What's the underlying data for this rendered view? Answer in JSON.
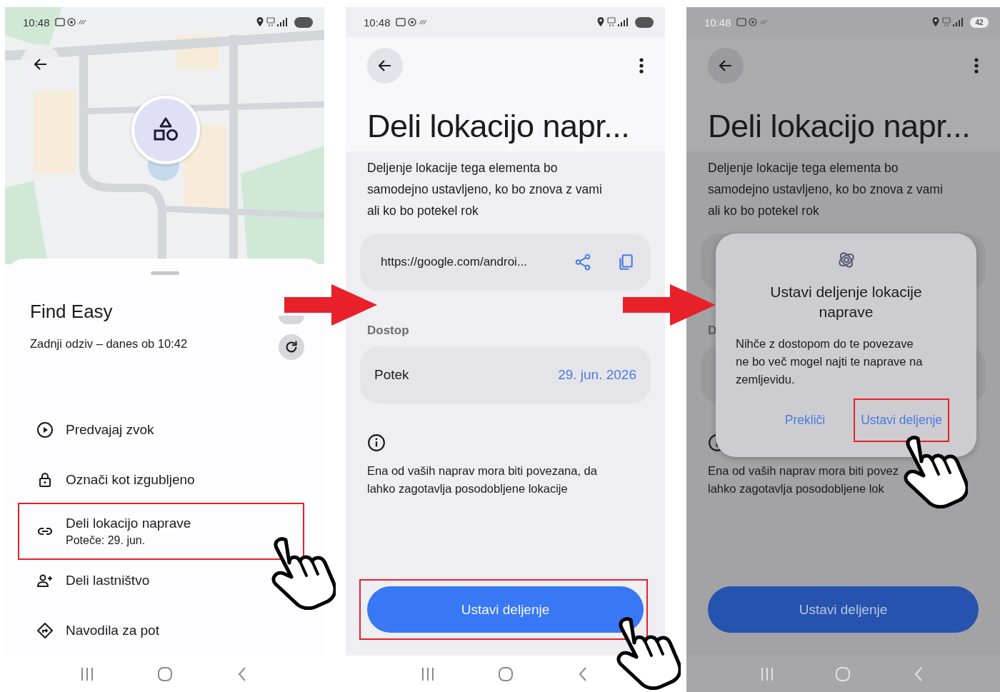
{
  "panels": [
    {
      "kind": "map_sheet",
      "status_bar": {
        "time": "10:48"
      },
      "sheet": {
        "title": "Find Easy",
        "subtitle": "Zadnji odziv – danes ob 10:42",
        "menu": [
          {
            "label": "Predvajaj zvok",
            "highlighted": false
          },
          {
            "label": "Označi kot izgubljeno",
            "highlighted": false
          },
          {
            "label": "Deli lokacijo naprave",
            "detail": "Poteče: 29. jun.",
            "highlighted": true
          },
          {
            "label": "Deli lastništvo",
            "highlighted": false
          },
          {
            "label": "Navodila za pot",
            "highlighted": false
          }
        ]
      }
    },
    {
      "kind": "share_detail",
      "dimmed": false,
      "status_bar": {
        "time": "10:48"
      },
      "title": "Deli lokacijo napr...",
      "description": "Deljenje lokacije tega elementa bo\nsamodejno ustavljeno, ko bo znova z vami\nali ko bo potekel rok",
      "link": {
        "url": "https://google.com/androi..."
      },
      "section_label": "Dostop",
      "expiry": {
        "label": "Potek",
        "value": "29. jun. 2026"
      },
      "info": "Ena od vaših naprav mora biti povezana, da\nlahko zagotavlja posodobljene lokacije",
      "button": {
        "label": "Ustavi deljenje",
        "highlighted": true
      }
    },
    {
      "kind": "share_detail",
      "dimmed": true,
      "status_bar": {
        "time": "10:48",
        "battery": "42"
      },
      "title": "Deli lokacijo napr...",
      "description": "Deljenje lokacije tega elementa bo\nsamodejno ustavljeno, ko bo znova z vami\nali ko bo potekel rok",
      "section_label": "D",
      "info": "Ena od vaših naprav mora biti povez\nlahko zagotavlja posodobljene lok",
      "button": {
        "label": "Ustavi deljenje",
        "highlighted": false
      },
      "dialog": {
        "title": "Ustavi deljenje lokacije naprave",
        "body": "Nihče z dostopom do te povezave\nne bo več mogel najti te naprave na\nzemljevidu.",
        "buttons": [
          {
            "label": "Prekliči",
            "highlighted": false
          },
          {
            "label": "Ustavi deljenje",
            "highlighted": true
          }
        ]
      }
    }
  ]
}
